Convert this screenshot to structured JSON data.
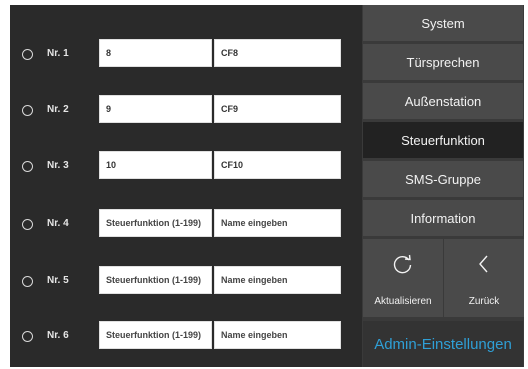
{
  "rows": [
    {
      "label": "Nr. 1",
      "field1": "8",
      "field2": "CF8"
    },
    {
      "label": "Nr. 2",
      "field1": "9",
      "field2": "CF9"
    },
    {
      "label": "Nr. 3",
      "field1": "10",
      "field2": "CF10"
    },
    {
      "label": "Nr. 4",
      "placeholder1": "Steuerfunktion (1-199)",
      "placeholder2": "Name eingeben"
    },
    {
      "label": "Nr. 5",
      "placeholder1": "Steuerfunktion (1-199)",
      "placeholder2": "Name eingeben"
    },
    {
      "label": "Nr. 6",
      "placeholder1": "Steuerfunktion (1-199)",
      "placeholder2": "Name eingeben"
    }
  ],
  "menu": {
    "items": [
      "System",
      "Türsprechen",
      "Außenstation",
      "Steuerfunktion",
      "SMS-Gruppe",
      "Information"
    ],
    "refresh_label": "Aktualisieren",
    "back_label": "Zurück",
    "refresh_icon": "refresh-icon",
    "back_icon": "chevron-left-icon",
    "footer": "Admin-Einstellungen"
  },
  "colors": {
    "background": "#2a2a2a",
    "menu_button": "#4a4a4a",
    "menu_active": "#222222",
    "accent": "#2f9fd6"
  }
}
